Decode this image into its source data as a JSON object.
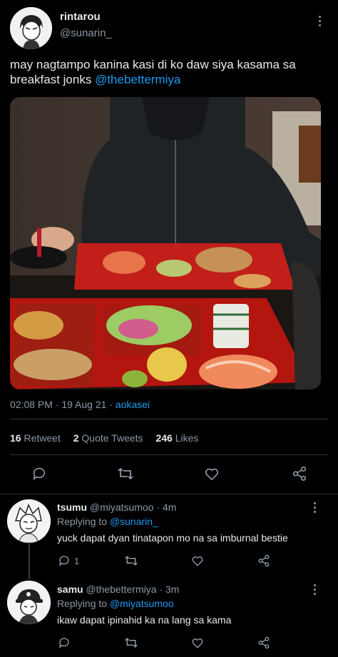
{
  "author": {
    "display_name": "rintarou",
    "handle": "@sunarin_"
  },
  "tweet": {
    "text_before": "may nagtampo kanina kasi di ko daw siya kasama sa breakfast jonks",
    "mention": "@thebettermiya",
    "time": "02:08 PM · 19 Aug 21 · ",
    "source": "aokasei"
  },
  "stats": {
    "retweets_count": "16",
    "retweets_label": "Retweet",
    "quotes_count": "2",
    "quotes_label": "Quote Tweets",
    "likes_count": "246",
    "likes_label": "Likes"
  },
  "actions": [
    "reply-icon",
    "retweet-icon",
    "like-icon",
    "share-icon"
  ],
  "replies": [
    {
      "name": "tsumu",
      "handle_time": "@miyatsumoo · 4m",
      "replying_label": "Replying to ",
      "replying_to": "@sunarin_",
      "text": "yuck dapat dyan tinatapon mo na sa imburnal bestie",
      "reply_count": "1"
    },
    {
      "name": "samu",
      "handle_time": "@thebettermiya · 3m",
      "replying_label": "Replying to ",
      "replying_to": "@miyatsumoo",
      "text": "ikaw dapat ipinahid ka na lang sa kama",
      "reply_count": ""
    }
  ],
  "colors": {
    "background": "#000000",
    "link": "#1d9bf0",
    "muted": "#8b98a5",
    "divider": "#2f3336"
  }
}
